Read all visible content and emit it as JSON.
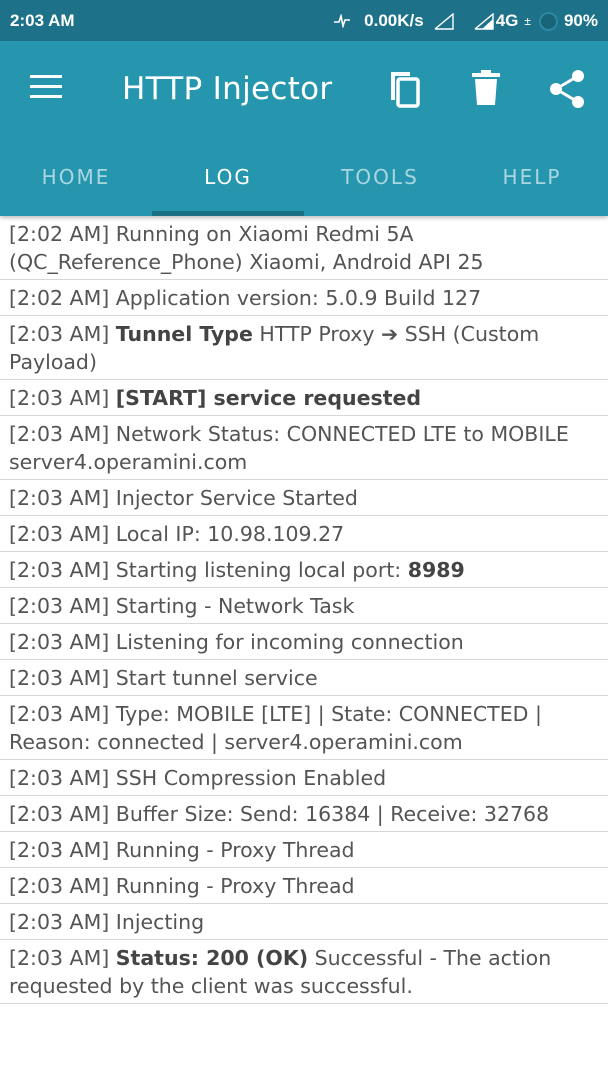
{
  "status_bar": {
    "time": "2:03 AM",
    "speed": "0.00K/s",
    "network": "4G",
    "network_sub": "±",
    "battery": "90%"
  },
  "app_bar": {
    "title": "HTTP Injector",
    "icons": [
      "menu-icon",
      "copy-icon",
      "delete-icon",
      "share-icon"
    ],
    "colors": {
      "primary": "#2596ad",
      "status": "#1d7289",
      "indicator": "#1b6f82"
    }
  },
  "tabs": [
    {
      "label": "HOME",
      "active": false
    },
    {
      "label": "LOG",
      "active": true
    },
    {
      "label": "TOOLS",
      "active": false
    },
    {
      "label": "HELP",
      "active": false
    }
  ],
  "log": [
    {
      "pre": "[2:02 AM] Running on Xiaomi Redmi 5A (QC_Reference_Phone) Xiaomi, Android API 25",
      "bold": "",
      "post": ""
    },
    {
      "pre": "[2:02 AM] Application version: 5.0.9 Build 127",
      "bold": "",
      "post": ""
    },
    {
      "pre": "[2:03 AM] ",
      "bold": "Tunnel Type",
      "post": " HTTP Proxy ➔ SSH (Custom Payload)"
    },
    {
      "pre": "[2:03 AM] ",
      "bold": "[START] service requested",
      "post": ""
    },
    {
      "pre": "[2:03 AM] Network Status: CONNECTED LTE to MOBILE server4.operamini.com",
      "bold": "",
      "post": ""
    },
    {
      "pre": "[2:03 AM] Injector Service Started",
      "bold": "",
      "post": ""
    },
    {
      "pre": "[2:03 AM] Local IP: 10.98.109.27",
      "bold": "",
      "post": ""
    },
    {
      "pre": "[2:03 AM] Starting listening local port: ",
      "bold": "8989",
      "post": ""
    },
    {
      "pre": "[2:03 AM] Starting - Network Task",
      "bold": "",
      "post": ""
    },
    {
      "pre": "[2:03 AM] Listening for incoming connection",
      "bold": "",
      "post": ""
    },
    {
      "pre": "[2:03 AM] Start tunnel service",
      "bold": "",
      "post": ""
    },
    {
      "pre": "[2:03 AM] Type: MOBILE [LTE] | State: CONNECTED | Reason: connected | server4.operamini.com",
      "bold": "",
      "post": ""
    },
    {
      "pre": "[2:03 AM] SSH Compression Enabled",
      "bold": "",
      "post": ""
    },
    {
      "pre": "[2:03 AM] Buffer Size: Send: 16384 | Receive: 32768",
      "bold": "",
      "post": ""
    },
    {
      "pre": "[2:03 AM] Running - Proxy Thread",
      "bold": "",
      "post": ""
    },
    {
      "pre": "[2:03 AM] Running - Proxy Thread",
      "bold": "",
      "post": ""
    },
    {
      "pre": "[2:03 AM] Injecting",
      "bold": "",
      "post": ""
    },
    {
      "pre": "[2:03 AM] ",
      "bold": "Status: 200 (OK)",
      "post": " Successful - The action requested by the client was successful."
    }
  ]
}
